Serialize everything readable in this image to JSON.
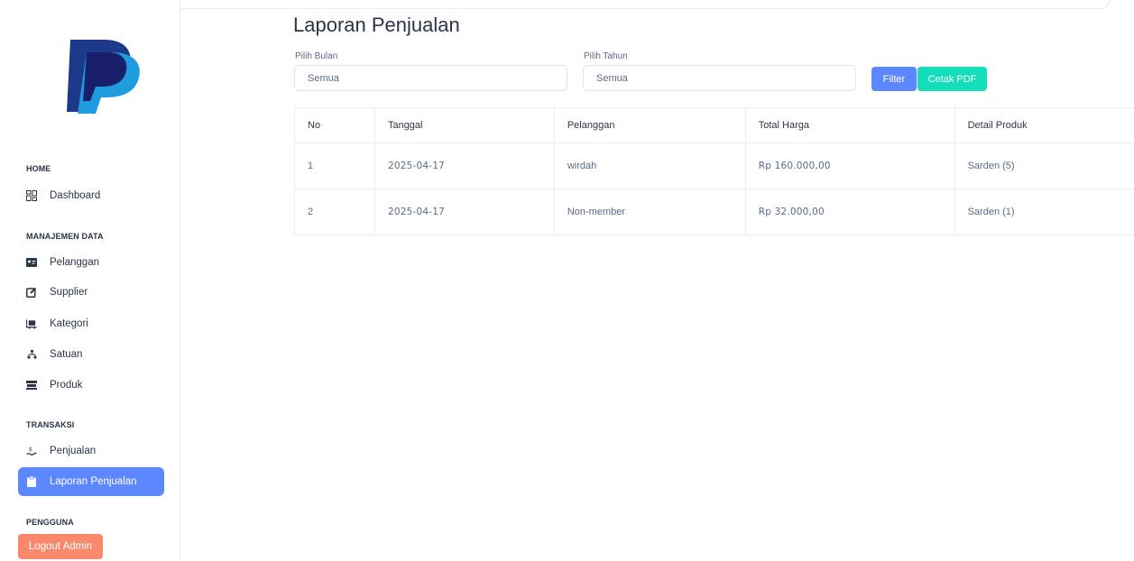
{
  "sidebar": {
    "sections": {
      "home": "HOME",
      "data": "MANAJEMEN DATA",
      "transaksi": "TRANSAKSI",
      "pengguna": "PENGGUNA"
    },
    "items": {
      "dashboard": "Dashboard",
      "pelanggan": "Pelanggan",
      "supplier": "Supplier",
      "kategori": "Kategori",
      "satuan": "Satuan",
      "produk": "Produk",
      "penjualan": "Penjualan",
      "laporan": "Laporan Penjualan"
    },
    "logout": "Logout Admin"
  },
  "page": {
    "title": "Laporan Penjualan"
  },
  "filters": {
    "month_label": "Pilih Bulan",
    "month_value": "Semua",
    "year_label": "Pilih Tahun",
    "year_value": "Semua",
    "filter_button": "Filter",
    "pdf_button": "Cetak PDF"
  },
  "table": {
    "headers": [
      "No",
      "Tanggal",
      "Pelanggan",
      "Total Harga",
      "Detail Produk"
    ],
    "rows": [
      [
        "1",
        "2025-04-17",
        "wirdah",
        "Rp 160.000,00",
        "Sarden (5)"
      ],
      [
        "2",
        "2025-04-17",
        "Non-member",
        "Rp 32.000,00",
        "Sarden (1)"
      ]
    ]
  },
  "colors": {
    "primary": "#5d87ff",
    "success": "#13deb9",
    "danger": "#fa896b"
  },
  "icons": {
    "logo": "paypal-logo",
    "dashboard": "dashboard-icon",
    "pelanggan": "id-card-icon",
    "supplier": "edit-icon",
    "kategori": "box-truck-icon",
    "satuan": "hierarchy-icon",
    "produk": "shelf-icon",
    "penjualan": "hand-coin-icon",
    "laporan": "clipboard-icon"
  }
}
